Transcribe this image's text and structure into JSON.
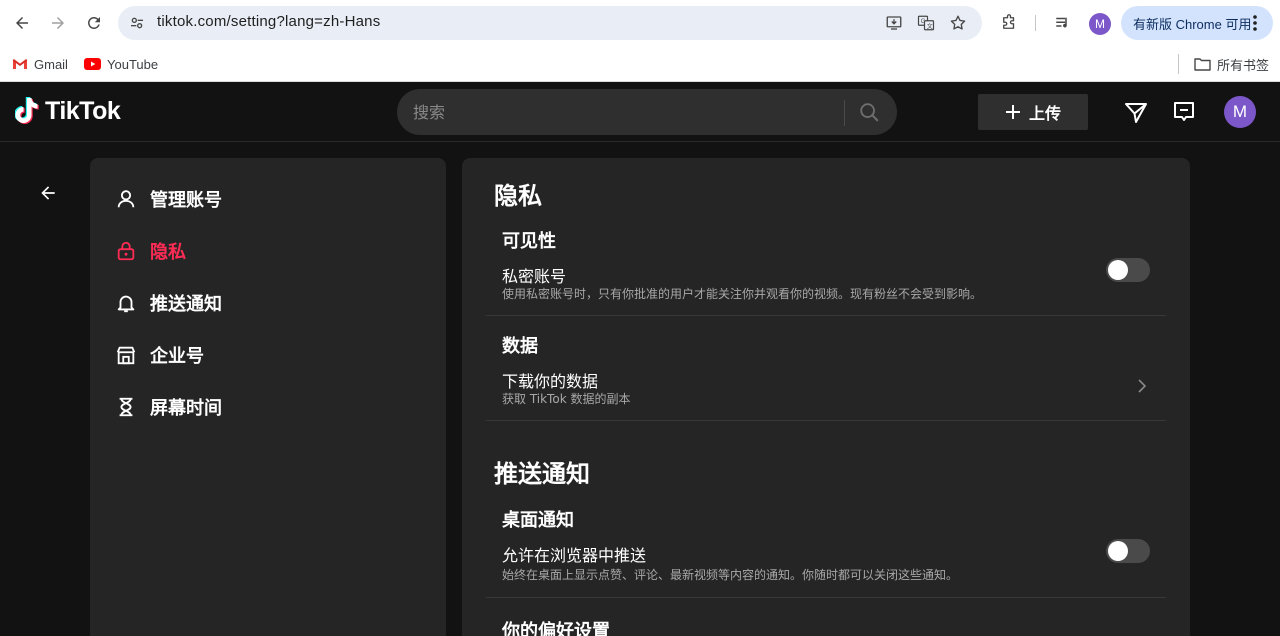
{
  "browser": {
    "url": "tiktok.com/setting?lang=zh-Hans",
    "profile_initial": "M",
    "update_label": "有新版 Chrome 可用",
    "icons": [
      "back-icon",
      "forward-icon",
      "reload-icon",
      "tune-icon",
      "install-icon",
      "translate-icon",
      "star-icon",
      "extensions-icon",
      "media-icon",
      "more-vert-icon"
    ]
  },
  "bookmarks": {
    "items": [
      {
        "label": "Gmail",
        "icon": "gmail-icon"
      },
      {
        "label": "YouTube",
        "icon": "youtube-icon"
      }
    ],
    "all_bookmarks": "所有书签"
  },
  "header": {
    "logo": "TikTok",
    "search_placeholder": "搜索",
    "upload_label": "上传",
    "avatar_initial": "M",
    "icons": [
      "send-icon",
      "inbox-icon"
    ]
  },
  "sidebar": {
    "items": [
      {
        "label": "管理账号",
        "icon": "person-icon",
        "active": false
      },
      {
        "label": "隐私",
        "icon": "lock-icon",
        "active": true
      },
      {
        "label": "推送通知",
        "icon": "bell-icon",
        "active": false
      },
      {
        "label": "企业号",
        "icon": "store-icon",
        "active": false
      },
      {
        "label": "屏幕时间",
        "icon": "hourglass-icon",
        "active": false
      }
    ]
  },
  "content": {
    "privacy": {
      "title": "隐私",
      "visibility": {
        "title": "可见性",
        "private_account": {
          "label": "私密账号",
          "desc": "使用私密账号时，只有你批准的用户才能关注你并观看你的视频。现有粉丝不会受到影响。",
          "enabled": false
        }
      },
      "data": {
        "title": "数据",
        "download": {
          "label": "下载你的数据",
          "desc": "获取 TikTok 数据的副本"
        }
      }
    },
    "notifications": {
      "title": "推送通知",
      "desktop": {
        "title": "桌面通知",
        "browser_push": {
          "label": "允许在浏览器中推送",
          "desc": "始终在桌面上显示点赞、评论、最新视频等内容的通知。你随时都可以关闭这些通知。",
          "enabled": false
        }
      },
      "preferences_title": "你的偏好设置"
    }
  },
  "colors": {
    "accent": "#fe2c55",
    "background": "#121212",
    "panel": "#252525",
    "avatar": "#7b57c9"
  }
}
